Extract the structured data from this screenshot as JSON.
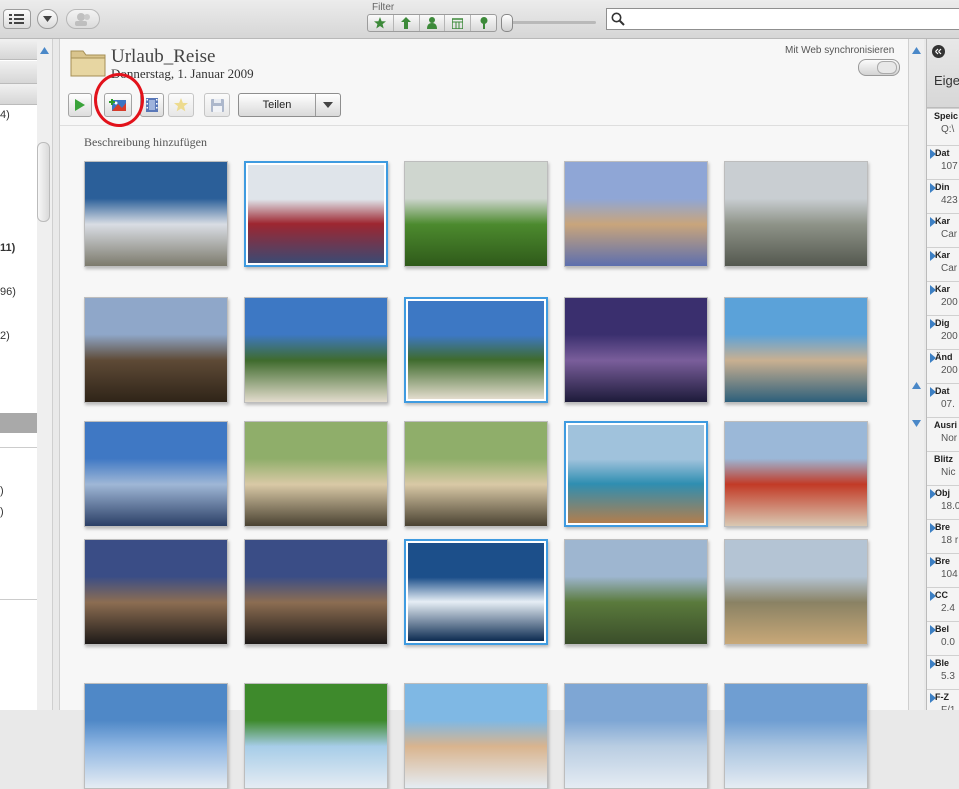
{
  "toolbar": {
    "filter_label": "Filter",
    "filter_icons": [
      "star-icon",
      "upload-arrow-icon",
      "person-icon",
      "calendar-icon",
      "pin-icon"
    ]
  },
  "left_sidebar": {
    "items": [
      {
        "text": "4)",
        "bold": false
      },
      {
        "text": "11)",
        "bold": true
      },
      {
        "text": "96)",
        "bold": false
      },
      {
        "text": "2)",
        "bold": false
      },
      {
        "text": ")",
        "bold": false
      },
      {
        "text": ")",
        "bold": false
      }
    ]
  },
  "album": {
    "title": "Urlaub_Reise",
    "date": "Donnerstag, 1. Januar 2009",
    "sync_label": "Mit Web synchronisieren",
    "share_label": "Teilen",
    "description_placeholder": "Beschreibung hinzufügen"
  },
  "colors": {
    "accent": "#3f9be0",
    "annotation": "#e2121b"
  },
  "photos": [
    {
      "name": "photo-castle",
      "selected": false,
      "colors": [
        "#2b5f99",
        "#d9dde4",
        "#7c7a6c"
      ]
    },
    {
      "name": "photo-luggage",
      "selected": true,
      "colors": [
        "#dfe4ea",
        "#9d2630",
        "#3b4a73"
      ]
    },
    {
      "name": "photo-tea-hills",
      "selected": false,
      "colors": [
        "#cfd6cf",
        "#4c8a2e",
        "#2f5a1a"
      ]
    },
    {
      "name": "photo-dresden",
      "selected": false,
      "colors": [
        "#8fa6d6",
        "#c9a57b",
        "#5d6fae"
      ]
    },
    {
      "name": "photo-airport",
      "selected": false,
      "colors": [
        "#c9ced2",
        "#8e9388",
        "#54584f"
      ]
    },
    {
      "name": "photo-mountains",
      "selected": false,
      "colors": [
        "#8fa7c9",
        "#5e4a36",
        "#2f2418"
      ]
    },
    {
      "name": "photo-palm-beach",
      "selected": false,
      "colors": [
        "#3d78c4",
        "#3f6b2d",
        "#e3dccd"
      ]
    },
    {
      "name": "photo-palm-beach-copy",
      "selected": true,
      "colors": [
        "#3d78c4",
        "#3f6b2d",
        "#e3dccd"
      ]
    },
    {
      "name": "photo-harbour-night",
      "selected": false,
      "colors": [
        "#3a2f6e",
        "#7a5e9b",
        "#1d1b3a"
      ]
    },
    {
      "name": "photo-amalfi",
      "selected": false,
      "colors": [
        "#5ba2d9",
        "#c9b091",
        "#2d5f7b"
      ]
    },
    {
      "name": "photo-frankfurt",
      "selected": false,
      "colors": [
        "#3f78c4",
        "#9fb7d6",
        "#2b3f66"
      ]
    },
    {
      "name": "photo-cottages",
      "selected": false,
      "colors": [
        "#8fae6a",
        "#d9c9a6",
        "#4a4232"
      ]
    },
    {
      "name": "photo-cottages-copy",
      "selected": false,
      "colors": [
        "#8fae6a",
        "#d9c9a6",
        "#4a4232"
      ]
    },
    {
      "name": "photo-coast",
      "selected": true,
      "colors": [
        "#a0c2dc",
        "#2f8eb1",
        "#b27e4d"
      ]
    },
    {
      "name": "photo-town-beach",
      "selected": false,
      "colors": [
        "#9bb8d8",
        "#c23a26",
        "#d9c8b2"
      ]
    },
    {
      "name": "photo-street-dusk",
      "selected": false,
      "colors": [
        "#3a4d86",
        "#8c6d52",
        "#1e1a18"
      ]
    },
    {
      "name": "photo-street-dusk-copy",
      "selected": false,
      "colors": [
        "#3a4d86",
        "#8c6d52",
        "#1e1a18"
      ]
    },
    {
      "name": "photo-iceberg",
      "selected": true,
      "colors": [
        "#1c4f8a",
        "#e6eef5",
        "#0d2c52"
      ]
    },
    {
      "name": "photo-green-hills",
      "selected": false,
      "colors": [
        "#9eb6d0",
        "#5a7a3c",
        "#3a4d2a"
      ]
    },
    {
      "name": "photo-lake-shore",
      "selected": false,
      "colors": [
        "#b4c4d4",
        "#8a8264",
        "#c8a878"
      ]
    },
    {
      "name": "photo-row5-1",
      "selected": false,
      "colors": [
        "#4f88c7",
        "#8fb6e2",
        "#e5ecf3"
      ]
    },
    {
      "name": "photo-row5-2",
      "selected": false,
      "colors": [
        "#3e8a2c",
        "#a7cde8",
        "#e5ecf3"
      ]
    },
    {
      "name": "photo-row5-3",
      "selected": false,
      "colors": [
        "#7fb8e4",
        "#d9b48e",
        "#e5ecf3"
      ]
    },
    {
      "name": "photo-row5-4",
      "selected": false,
      "colors": [
        "#7ea6d4",
        "#b9cde2",
        "#e5ecf3"
      ]
    },
    {
      "name": "photo-row5-5",
      "selected": false,
      "colors": [
        "#6f9ed2",
        "#a9c4e0",
        "#e5ecf3"
      ]
    }
  ],
  "right_panel": {
    "header": "Eigen",
    "properties": [
      {
        "key": "Speic",
        "value": "Q:\\",
        "expandable": false
      },
      {
        "key": "Dat",
        "value": "107",
        "expandable": true
      },
      {
        "key": "Din",
        "value": "423",
        "expandable": true
      },
      {
        "key": "Kar",
        "value": "Car",
        "expandable": true
      },
      {
        "key": "Kar",
        "value": "Car",
        "expandable": true
      },
      {
        "key": "Kar",
        "value": "200",
        "expandable": true
      },
      {
        "key": "Dig",
        "value": "200",
        "expandable": true
      },
      {
        "key": "Änd",
        "value": "200",
        "expandable": true
      },
      {
        "key": "Dat",
        "value": "07.",
        "expandable": true
      },
      {
        "key": "Ausri",
        "value": "Nor",
        "expandable": false
      },
      {
        "key": "Blitz",
        "value": "Nic",
        "expandable": false
      },
      {
        "key": "Obj",
        "value": "18.0",
        "expandable": true
      },
      {
        "key": "Bre",
        "value": "18 r",
        "expandable": true
      },
      {
        "key": "Bre",
        "value": "104",
        "expandable": true
      },
      {
        "key": "CC",
        "value": "2.4",
        "expandable": true
      },
      {
        "key": "Bel",
        "value": "0.0",
        "expandable": true
      },
      {
        "key": "Ble",
        "value": "5.3",
        "expandable": true
      },
      {
        "key": "F-Z",
        "value": "F/1",
        "expandable": true
      }
    ]
  }
}
